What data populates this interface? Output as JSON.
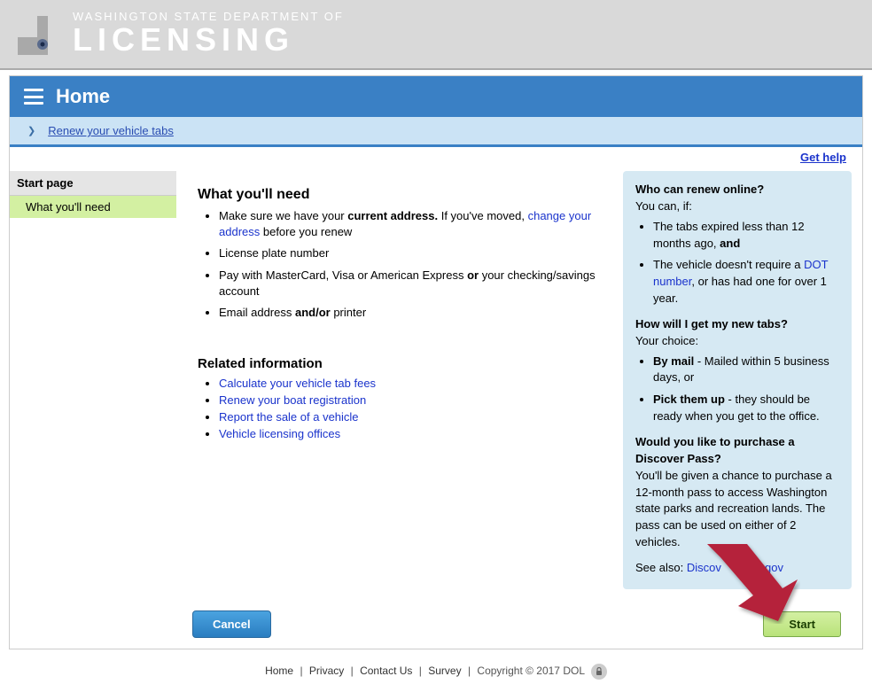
{
  "header": {
    "agency": "WASHINGTON STATE DEPARTMENT OF",
    "logo_word": "LICENSING",
    "page_title": "Home",
    "breadcrumb": "Renew your vehicle tabs"
  },
  "sidebar": {
    "heading": "Start page",
    "active_item": "What you'll need"
  },
  "help_link": "Get help",
  "needs": {
    "title": "What you'll need",
    "items": {
      "addr_pre": "Make sure we have your ",
      "addr_bold": "current address.",
      "addr_post": " If you've moved, ",
      "addr_link": "change your address",
      "addr_tail": " before you renew",
      "plate": "License plate number",
      "pay_pre": "Pay with MasterCard, Visa or American Express ",
      "pay_bold": "or",
      "pay_post": " your checking/savings account",
      "email_pre": "Email address ",
      "email_bold": "and/or",
      "email_post": " printer"
    }
  },
  "related": {
    "heading": "Related information",
    "links": [
      "Calculate your vehicle tab fees",
      "Renew your boat registration",
      "Report the sale of a vehicle",
      "Vehicle licensing offices"
    ]
  },
  "info": {
    "q1": "Who can renew online?",
    "q1_lead": "You can, if:",
    "q1_a_pre": "The tabs expired less than 12 months ago, ",
    "q1_a_bold": "and",
    "q1_b_pre": "The vehicle doesn't require a ",
    "q1_b_link": "DOT number",
    "q1_b_post": ", or has had one for over 1 year.",
    "q2": "How will I get my new tabs?",
    "q2_lead": "Your choice:",
    "q2_a_bold": "By mail",
    "q2_a_post": " - Mailed within 5 business days, or",
    "q2_b_bold": "Pick them up",
    "q2_b_post": " - they should be ready when you get to the office.",
    "q3": "Would you like to purchase a Discover Pass?",
    "q3_body": "You'll be given a chance to purchase a 12-month pass to access Washington state parks and recreation lands. The pass can be used on either of 2 vehicles.",
    "see_also_label": "See also: ",
    "see_also_link_pre": "Discov",
    "see_also_link_post": "wa.gov"
  },
  "buttons": {
    "cancel": "Cancel",
    "start": "Start"
  },
  "footer": {
    "home": "Home",
    "privacy": "Privacy",
    "contact": "Contact Us",
    "survey": "Survey",
    "copyright": "Copyright © 2017 DOL"
  }
}
